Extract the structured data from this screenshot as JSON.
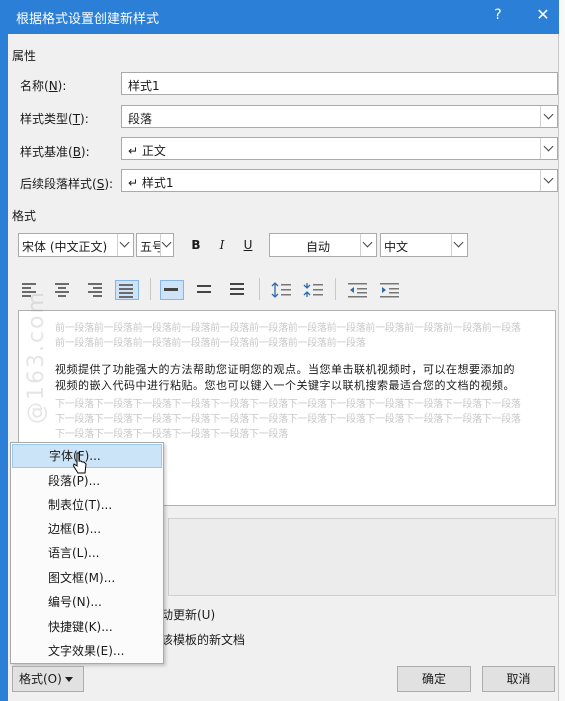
{
  "window": {
    "title": "根据格式设置创建新样式",
    "help": "?",
    "close": "✕"
  },
  "properties": {
    "section": "属性",
    "name": {
      "label": "名称(",
      "key": "N",
      "suffix": "):",
      "value": "样式1"
    },
    "style_type": {
      "label": "样式类型(",
      "key": "T",
      "suffix": "):",
      "value": "段落"
    },
    "based_on": {
      "label": "样式基准(",
      "key": "B",
      "suffix": "):",
      "value": "↵ 正文"
    },
    "next_style": {
      "label": "后续段落样式(",
      "key": "S",
      "suffix": "):",
      "value": "↵ 样式1"
    }
  },
  "format": {
    "section": "格式",
    "font": "宋体 (中文正文)",
    "size": "五号",
    "bold": "B",
    "italic": "I",
    "underline": "U",
    "color": "自动",
    "language": "中文"
  },
  "preview": {
    "prev_para": "前一段落前一段落前一段落前一段落前一段落前一段落前一段落前一段落前一段落前一段落前一段落前一段落前一段落前一段落前一段落前一段落前一段落前一段落前一段落前一段落",
    "sample": "视频提供了功能强大的方法帮助您证明您的观点。当您单击联机视频时，可以在想要添加的视频的嵌入代码中进行粘贴。您也可以键入一个关键字以联机搜索最适合您的文档的视频。",
    "next_para": "下一段落下一段落下一段落下一段落下一段落下一段落下一段落下一段落下一段落下一段落下一段落下一段落下一段落下一段落下一段落下一段落下一段落下一段落下一段落下一段落下一段落下一段落下一段落下一段落下一段落下一段落下一段落下一段落下一段落下一段落"
  },
  "options": {
    "auto_update": "动更新(U)",
    "new_docs": "该模板的新文档"
  },
  "menu": {
    "items": [
      "字体(F)...",
      "段落(P)...",
      "制表位(T)...",
      "边框(B)...",
      "语言(L)...",
      "图文框(M)...",
      "编号(N)...",
      "快捷键(K)...",
      "文字效果(E)..."
    ]
  },
  "buttons": {
    "format": "格式(O)",
    "ok": "确定",
    "cancel": "取消"
  },
  "watermark": "@163.com"
}
